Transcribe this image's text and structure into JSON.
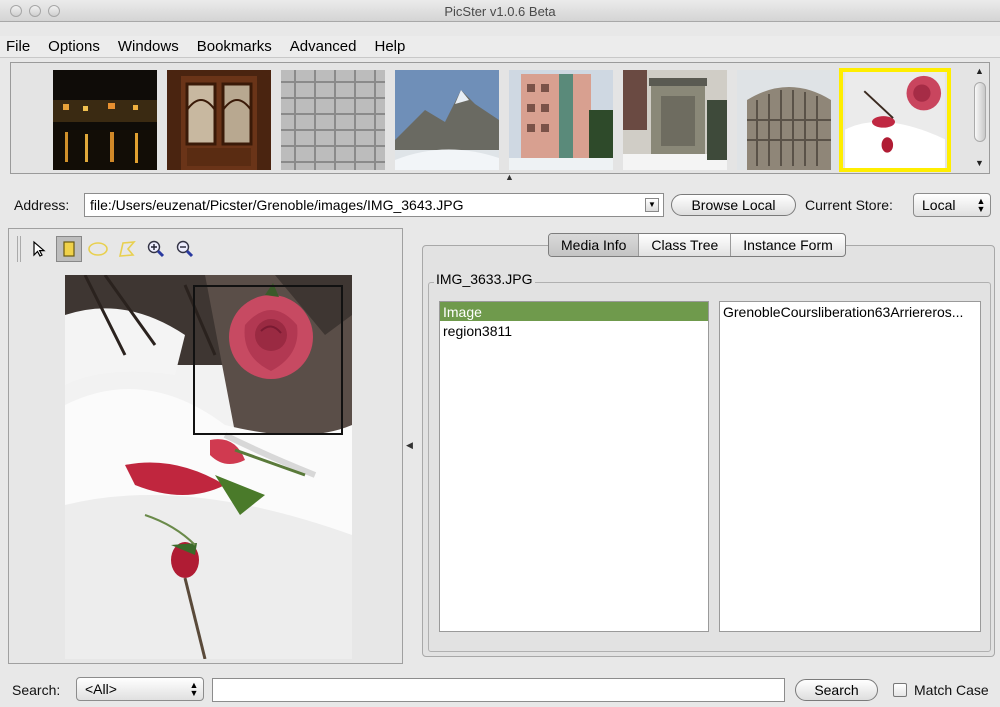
{
  "window": {
    "title": "PicSter v1.0.6 Beta"
  },
  "menu": [
    "File",
    "Options",
    "Windows",
    "Bookmarks",
    "Advanced",
    "Help"
  ],
  "address": {
    "label": "Address:",
    "value": "file:/Users/euzenat/Picster/Grenoble/images/IMG_3643.JPG",
    "browse_label": "Browse Local",
    "store_label": "Current Store:",
    "store_value": "Local"
  },
  "tabs": [
    "Media Info",
    "Class Tree",
    "Instance Form"
  ],
  "media": {
    "group_title": "IMG_3633.JPG",
    "left_items": [
      "Image",
      "region3811"
    ],
    "right_items": [
      "GrenobleCoursliberation63Arriereros..."
    ]
  },
  "search": {
    "label": "Search:",
    "scope": "<All>",
    "button_label": "Search",
    "match_case_label": "Match Case"
  },
  "colors": {
    "selection": "#6f9a4c",
    "thumb_highlight": "#ffee00"
  }
}
